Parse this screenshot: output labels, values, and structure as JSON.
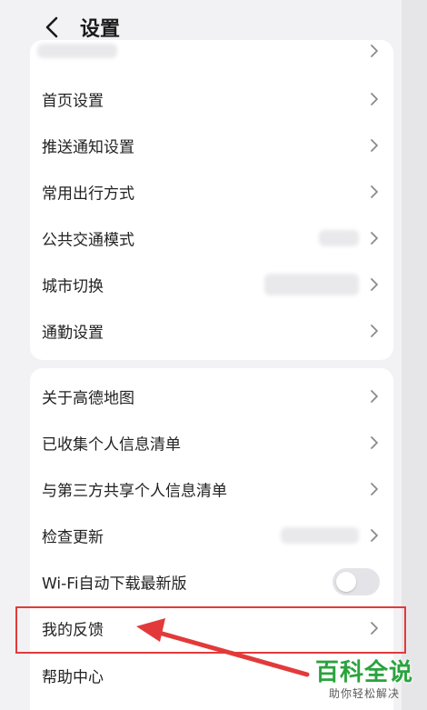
{
  "header": {
    "title": "设置"
  },
  "group1": {
    "items": [
      {
        "label": "首页设置"
      },
      {
        "label": "推送通知设置"
      },
      {
        "label": "常用出行方式"
      },
      {
        "label": "公共交通模式"
      },
      {
        "label": "城市切换"
      },
      {
        "label": "通勤设置"
      }
    ]
  },
  "group2": {
    "items": [
      {
        "label": "关于高德地图"
      },
      {
        "label": "已收集个人信息清单"
      },
      {
        "label": "与第三方共享个人信息清单"
      },
      {
        "label": "检查更新"
      },
      {
        "label": "Wi-Fi自动下载最新版"
      },
      {
        "label": "我的反馈"
      },
      {
        "label": "帮助中心"
      }
    ],
    "wifi_toggle_on": false
  },
  "watermark": {
    "main": "百科全说",
    "sub": "助你轻松解决"
  },
  "colors": {
    "highlight": "#e23a3a",
    "watermark": "#2aa33d"
  },
  "icons": [
    "back-arrow-icon",
    "chevron-right-icon"
  ]
}
